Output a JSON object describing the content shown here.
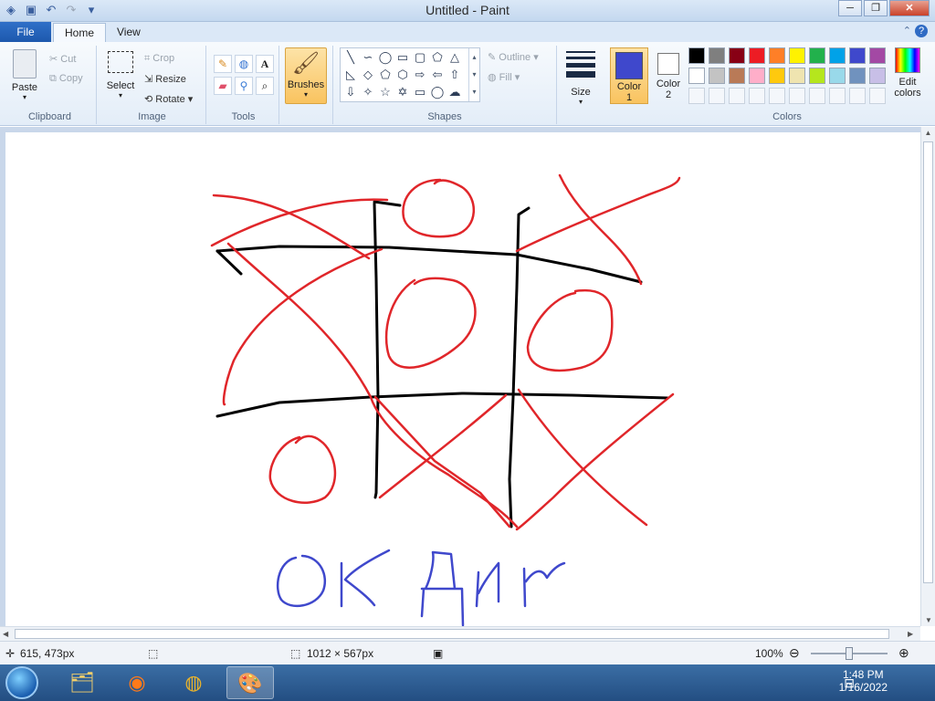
{
  "window": {
    "title": "Untitled - Paint"
  },
  "tabs": {
    "file": "File",
    "home": "Home",
    "view": "View"
  },
  "clipboard": {
    "paste": "Paste",
    "cut": "Cut",
    "copy": "Copy",
    "label": "Clipboard"
  },
  "image": {
    "select": "Select",
    "crop": "Crop",
    "resize": "Resize",
    "rotate": "Rotate",
    "label": "Image"
  },
  "tools": {
    "label": "Tools",
    "text_tool": "A"
  },
  "brushes": {
    "label": "Brushes"
  },
  "shapes": {
    "outline": "Outline",
    "fill": "Fill",
    "label": "Shapes"
  },
  "size": {
    "label": "Size"
  },
  "colors": {
    "color1_label": "Color\n1",
    "color1_line1": "Color",
    "color1_line2": "1",
    "color2_line1": "Color",
    "color2_line2": "2",
    "edit_line1": "Edit",
    "edit_line2": "colors",
    "label": "Colors",
    "color1": "#3f48cc",
    "color2": "#ffffff",
    "palette_row1": [
      "#000000",
      "#7f7f7f",
      "#880015",
      "#ed1c24",
      "#ff7f27",
      "#fff200",
      "#22b14c",
      "#00a2e8",
      "#3f48cc",
      "#a349a4"
    ],
    "palette_row2": [
      "#ffffff",
      "#c3c3c3",
      "#b97a57",
      "#ffaec9",
      "#ffc90e",
      "#efe4b0",
      "#b5e61d",
      "#99d9ea",
      "#7092be",
      "#c8bfe7"
    ]
  },
  "drawing": {
    "ink_red": "#e0262a",
    "ink_black": "#000000",
    "ink_blue": "#3f48cc"
  },
  "status": {
    "cursor_pos": "615, 473px",
    "canvas_size": "1012 × 567px",
    "zoom": "100%"
  },
  "taskbar": {
    "time": "1:48 PM",
    "date": "1/16/2022"
  }
}
